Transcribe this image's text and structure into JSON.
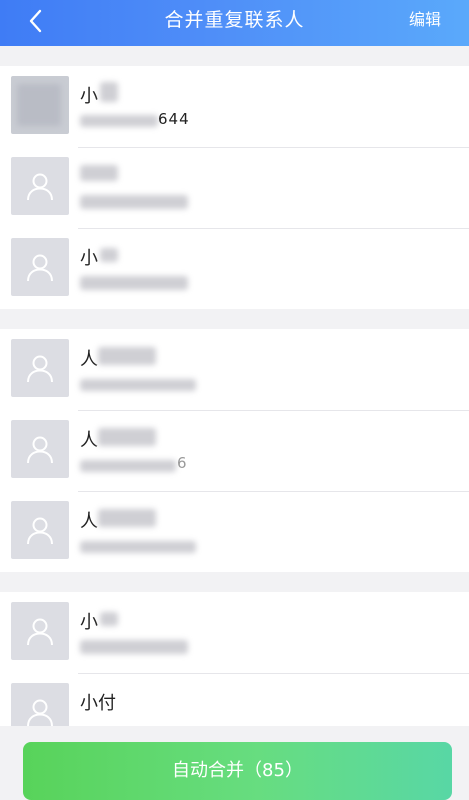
{
  "nav": {
    "title": "合并重复联系人",
    "edit_label": "编辑"
  },
  "groups": [
    {
      "contacts": [
        {
          "name": "小",
          "phone": "644"
        },
        {
          "name": "",
          "phone": ""
        },
        {
          "name": "小",
          "phone": ""
        }
      ]
    },
    {
      "contacts": [
        {
          "name": "人",
          "phone": ""
        },
        {
          "name": "人",
          "phone": "6"
        },
        {
          "name": "人",
          "phone": ""
        }
      ]
    },
    {
      "contacts": [
        {
          "name": "小",
          "phone": ""
        },
        {
          "name": "小付",
          "phone": ""
        }
      ]
    }
  ],
  "footer": {
    "merge_label": "自动合并（85）"
  },
  "colors": {
    "nav_start": "#3f7cf5",
    "nav_end": "#5aa9fb",
    "button_start": "#58d35a",
    "button_end": "#58d7a5"
  }
}
